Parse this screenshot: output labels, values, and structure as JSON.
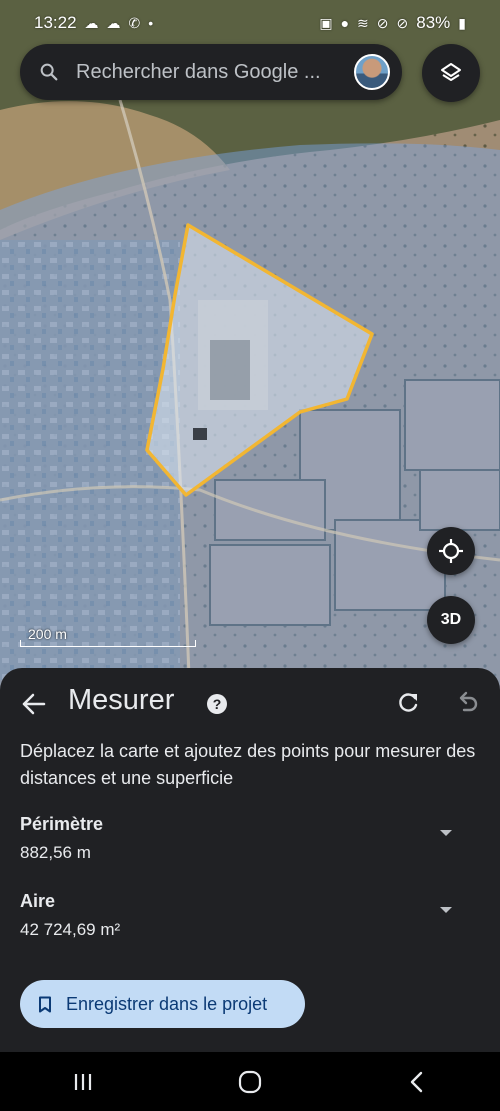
{
  "status_bar": {
    "time": "13:22",
    "battery": "83%",
    "left_icons": [
      "cloud-icon",
      "cloud-icon",
      "call-icon",
      "dot-icon"
    ],
    "right_icons": [
      "battery-saver-icon",
      "location-icon",
      "wifi-icon",
      "dnd-icon",
      "blocked-icon",
      "battery-icon"
    ]
  },
  "search": {
    "placeholder": "Rechercher dans Google ..."
  },
  "map": {
    "scale_label": "200 m",
    "three_d_label": "3D",
    "polygon_color": "#f2b632",
    "overlay_color": "#7aa7e8"
  },
  "sheet": {
    "title": "Mesurer",
    "help_label": "?",
    "instructions": "Déplacez la carte et ajoutez des points pour mesurer des distances et une superficie",
    "perimeter": {
      "label": "Périmètre",
      "value": "882,56 m"
    },
    "area": {
      "label": "Aire",
      "value": "42 724,69 m²"
    },
    "save_label": "Enregistrer dans le projet"
  },
  "colors": {
    "sheet_bg": "#202124",
    "save_button_bg": "#c2dbf5",
    "save_button_text": "#0b3a75"
  }
}
